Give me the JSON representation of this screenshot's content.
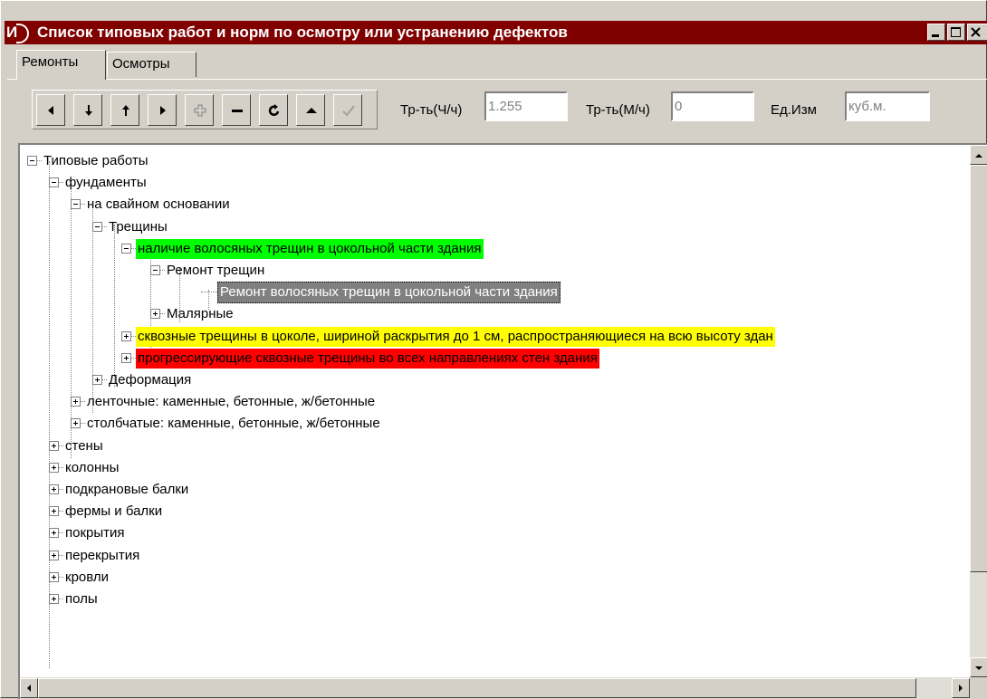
{
  "window": {
    "title": "Список типовых работ и норм по осмотру или устранению дефектов",
    "app_icon_text": "И",
    "titlebar_color": "#800000"
  },
  "tabs": [
    {
      "label": "Ремонты",
      "active": true
    },
    {
      "label": "Осмотры",
      "active": false
    }
  ],
  "toolbar": {
    "buttons": [
      "first-icon",
      "down-icon",
      "up-icon",
      "last-icon",
      "add-icon",
      "delete-icon",
      "refresh-icon",
      "cancel-icon",
      "confirm-icon"
    ]
  },
  "fields": {
    "labor_hours": {
      "label": "Тр-ть(Ч/ч)",
      "value": "1.255"
    },
    "machine_hours": {
      "label": "Тр-ть(М/ч)",
      "value": "0"
    },
    "unit": {
      "label": "Ед.Изм",
      "value": "куб.м."
    }
  },
  "tree": [
    {
      "label": "Типовые работы",
      "level": 0,
      "state": "expanded",
      "highlight": ""
    },
    {
      "label": "фундаменты",
      "level": 1,
      "state": "expanded",
      "highlight": ""
    },
    {
      "label": "на свайном основании",
      "level": 2,
      "state": "expanded",
      "highlight": ""
    },
    {
      "label": "Трещины",
      "level": 3,
      "state": "expanded",
      "highlight": ""
    },
    {
      "label": "наличие волосяных трещин в цокольной части здания",
      "level": 4,
      "state": "expanded",
      "highlight": "#00ff00"
    },
    {
      "label": "Ремонт трещин",
      "level": 5,
      "state": "expanded",
      "highlight": ""
    },
    {
      "label": "Ремонт волосяных трещин в цокольной части здания",
      "level": 6,
      "state": "leaf",
      "highlight": "selected"
    },
    {
      "label": "Малярные",
      "level": 5,
      "state": "collapsed",
      "highlight": ""
    },
    {
      "label": "сквозные трещины в цоколе, шириной раскрытия до 1 см, распространяющиеся на всю высоту здан",
      "level": 4,
      "state": "collapsed",
      "highlight": "#ffff00"
    },
    {
      "label": "прогрессирующие сквозные трещины во всех направлениях стен здания",
      "level": 4,
      "state": "collapsed",
      "highlight": "#ff0000"
    },
    {
      "label": "Деформация",
      "level": 3,
      "state": "collapsed",
      "highlight": ""
    },
    {
      "label": "ленточные: каменные, бетонные, ж/бетонные",
      "level": 2,
      "state": "collapsed",
      "highlight": ""
    },
    {
      "label": "столбчатые: каменные, бетонные, ж/бетонные",
      "level": 2,
      "state": "collapsed",
      "highlight": ""
    },
    {
      "label": "стены",
      "level": 1,
      "state": "collapsed",
      "highlight": ""
    },
    {
      "label": "колонны",
      "level": 1,
      "state": "collapsed",
      "highlight": ""
    },
    {
      "label": "подкрановые балки",
      "level": 1,
      "state": "collapsed",
      "highlight": ""
    },
    {
      "label": "фермы и балки",
      "level": 1,
      "state": "collapsed",
      "highlight": ""
    },
    {
      "label": "покрытия",
      "level": 1,
      "state": "collapsed",
      "highlight": ""
    },
    {
      "label": "перекрытия",
      "level": 1,
      "state": "collapsed",
      "highlight": ""
    },
    {
      "label": "кровли",
      "level": 1,
      "state": "collapsed",
      "highlight": ""
    },
    {
      "label": "полы",
      "level": 1,
      "state": "collapsed",
      "highlight": ""
    }
  ]
}
